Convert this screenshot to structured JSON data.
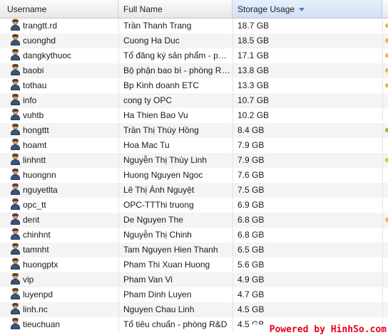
{
  "columns": {
    "username": "Username",
    "full_name": "Full Name",
    "storage_usage": "Storage Usage"
  },
  "sort": {
    "column": "storage_usage",
    "direction": "descending"
  },
  "colors": {
    "edge_dot_gold": "#e8b83a",
    "edge_dot_green": "#a0b53a",
    "watermark": "#e8001c"
  },
  "rows": [
    {
      "username": "trangtt.rd",
      "full_name": "Trần Thanh Trang",
      "storage": "18.7 GB",
      "edge": "gold"
    },
    {
      "username": "cuonghd",
      "full_name": "Cuong Ha Duc",
      "storage": "18.5 GB",
      "edge": "gold"
    },
    {
      "username": "dangkythuoc",
      "full_name": "Tổ đăng ký sản phẩm - phò...",
      "storage": "17.1 GB",
      "edge": "gold"
    },
    {
      "username": "baobi",
      "full_name": "Bộ phận bao bì - phòng R&D",
      "storage": "13.8 GB",
      "edge": "gold"
    },
    {
      "username": "tothau",
      "full_name": "Bp Kinh doanh ETC",
      "storage": "13.3 GB",
      "edge": "gold"
    },
    {
      "username": "info",
      "full_name": "cong ty OPC",
      "storage": "10.7 GB",
      "edge": "none"
    },
    {
      "username": "vuhtb",
      "full_name": "Ha Thien Bao Vu",
      "storage": "10.2 GB",
      "edge": "none"
    },
    {
      "username": "hongttt",
      "full_name": "Trần Thị Thúy Hồng",
      "storage": "8.4 GB",
      "edge": "green"
    },
    {
      "username": "hoamt",
      "full_name": "Hoa Mac Tu",
      "storage": "7.9 GB",
      "edge": "none"
    },
    {
      "username": "linhntt",
      "full_name": "Nguyễn Thị Thùy Linh",
      "storage": "7.9 GB",
      "edge": "gold"
    },
    {
      "username": "huongnn",
      "full_name": "Huong Nguyen Ngoc",
      "storage": "7.6 GB",
      "edge": "none"
    },
    {
      "username": "nguyetlta",
      "full_name": "Lê Thị Ánh Nguyệt",
      "storage": "7.5 GB",
      "edge": "none"
    },
    {
      "username": "opc_tt",
      "full_name": "OPC-TTThi truong",
      "storage": "6.9 GB",
      "edge": "none"
    },
    {
      "username": "dent",
      "full_name": "De Nguyen The",
      "storage": "6.8 GB",
      "edge": "gold"
    },
    {
      "username": "chinhnt",
      "full_name": "Nguyễn Thị Chinh",
      "storage": "6.8 GB",
      "edge": "none"
    },
    {
      "username": "tamnht",
      "full_name": "Tam Nguyen Hien Thanh",
      "storage": "6.5 GB",
      "edge": "none"
    },
    {
      "username": "huongptx",
      "full_name": "Pham Thi Xuan Huong",
      "storage": "5.6 GB",
      "edge": "none"
    },
    {
      "username": "vip",
      "full_name": "Pham Van Vi",
      "storage": "4.9 GB",
      "edge": "none"
    },
    {
      "username": "luyenpd",
      "full_name": "Pham Dinh Luyen",
      "storage": "4.7 GB",
      "edge": "none"
    },
    {
      "username": "linh.nc",
      "full_name": "Nguyen Chau Linh",
      "storage": "4.5 GB",
      "edge": "none"
    },
    {
      "username": "tieuchuan",
      "full_name": "Tổ tiêu chuẩn - phòng R&D",
      "storage": "4.5 GB",
      "edge": "none"
    }
  ],
  "watermark": "Powered by HinhSo.com"
}
